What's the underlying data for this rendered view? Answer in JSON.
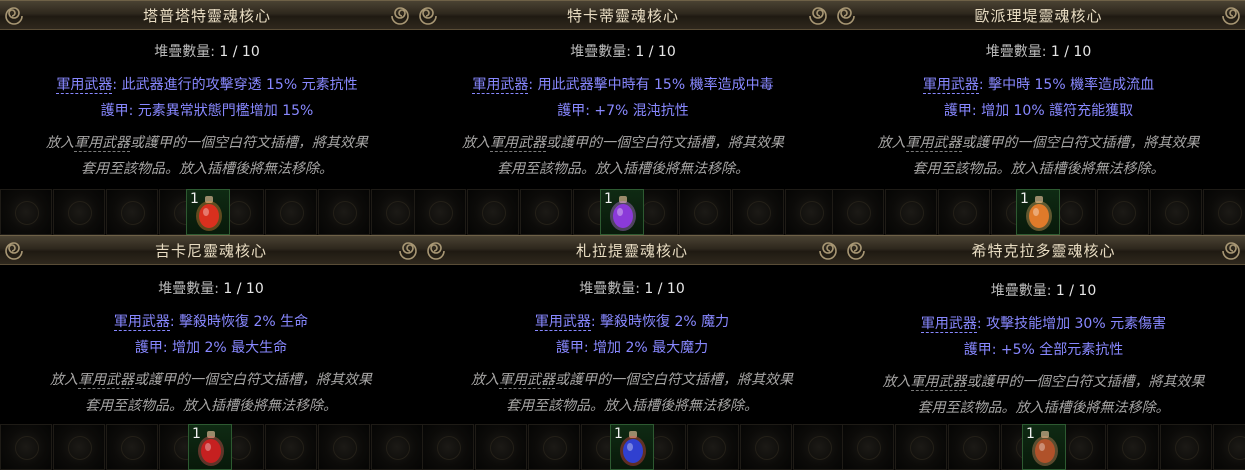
{
  "stack_label": "堆疊數量:",
  "weapon_label": "軍用武器",
  "armour_label": "護甲",
  "flavor_line1_parts": [
    "放入",
    "軍用武器",
    "或護甲的一個空白符文插槽，將其效果"
  ],
  "flavor_line2": "套用至該物品。放入插槽後將無法移除。",
  "cards": [
    {
      "title": "塔普塔特靈魂核心",
      "stack_value": "1 / 10",
      "weapon_effect": ": 此武器進行的攻擊穿透 15% 元素抗性",
      "armour_effect": ": 元素異常狀態門檻增加 15%",
      "item_count": "1",
      "item_color": "#d9301e",
      "item_glow": "#ff9a40"
    },
    {
      "title": "特卡蒂靈魂核心",
      "stack_value": "1 / 10",
      "weapon_effect": ": 用此武器擊中時有 15% 機率造成中毒",
      "armour_effect": ": +7% 混沌抗性",
      "item_count": "1",
      "item_color": "#8b3ad9",
      "item_glow": "#d38cff"
    },
    {
      "title": "歐派理堤靈魂核心",
      "stack_value": "1 / 10",
      "weapon_effect": ": 擊中時 15% 機率造成流血",
      "armour_effect": ": 增加 10% 護符充能獲取",
      "item_count": "1",
      "item_color": "#e07a2a",
      "item_glow": "#ffc070"
    },
    {
      "title": "吉卡尼靈魂核心",
      "stack_value": "1 / 10",
      "weapon_effect": ": 擊殺時恢復 2% 生命",
      "armour_effect": ": 增加 2% 最大生命",
      "item_count": "1",
      "item_color": "#c62020",
      "item_glow": "#ff6060"
    },
    {
      "title": "札拉提靈魂核心",
      "stack_value": "1 / 10",
      "weapon_effect": ": 擊殺時恢復 2% 魔力",
      "armour_effect": ": 增加 2% 最大魔力",
      "item_count": "1",
      "item_color": "#3040d0",
      "item_glow": "#ff5050"
    },
    {
      "title": "希特克拉多靈魂核心",
      "stack_value": "1 / 10",
      "weapon_effect": ": 攻擊技能增加 30% 元素傷害",
      "armour_effect": ": +5% 全部元素抗性",
      "item_count": "1",
      "item_color": "#b0522a",
      "item_glow": "#f0a070"
    }
  ]
}
